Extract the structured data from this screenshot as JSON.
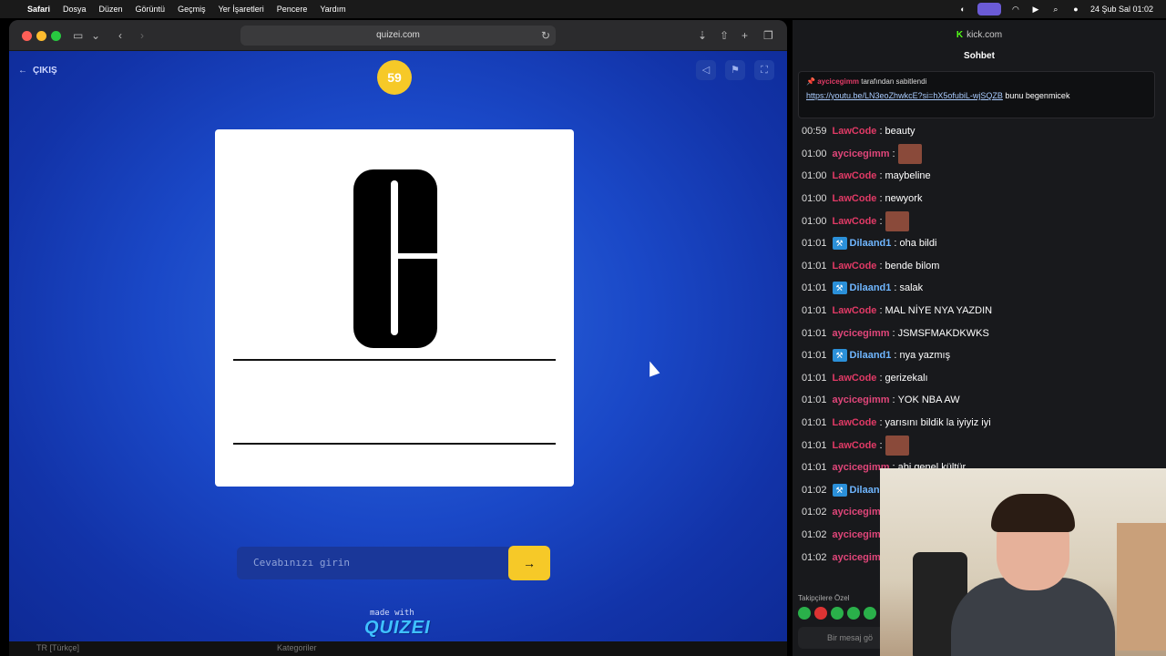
{
  "menubar": {
    "app": "Safari",
    "items": [
      "Dosya",
      "Düzen",
      "Görüntü",
      "Geçmiş",
      "Yer İşaretleri",
      "Pencere",
      "Yardım"
    ],
    "datetime": "24 Şub Sal  01:02"
  },
  "browser": {
    "url": "quizei.com"
  },
  "quiz": {
    "exit_label": "ÇIKIŞ",
    "timer": "59",
    "answer_placeholder": "Cevabınızı girin",
    "submit_label": "→",
    "made_with": "made with",
    "brand": "QUIZEI"
  },
  "bottom": {
    "lang": "TR  [Türkçe]",
    "categories": "Kategoriler"
  },
  "kick": {
    "url": "kick.com",
    "tab": "Sohbet",
    "pinned_by_user": "aycicegimm",
    "pinned_by_suffix": "tarafından sabitlendi",
    "pinned_link": "https://youtu.be/LN3eoZhwkcE?si=hX5ofubiL-wjSQZB",
    "pinned_text": "bunu begenmicek",
    "followers_only": "Takipçilere Özel",
    "message_placeholder": "Bir mesaj gö",
    "messages": [
      {
        "time": "00:59",
        "user": "LawCode",
        "type": "law",
        "text": "beauty"
      },
      {
        "time": "01:00",
        "user": "aycicegimm",
        "type": "ayc",
        "text": "",
        "emote": true
      },
      {
        "time": "01:00",
        "user": "LawCode",
        "type": "law",
        "text": "maybeline"
      },
      {
        "time": "01:00",
        "user": "LawCode",
        "type": "law",
        "text": "newyork"
      },
      {
        "time": "01:00",
        "user": "LawCode",
        "type": "law",
        "text": "",
        "emote": true
      },
      {
        "time": "01:01",
        "user": "Dilaand1",
        "type": "dil",
        "text": "oha bildi"
      },
      {
        "time": "01:01",
        "user": "LawCode",
        "type": "law",
        "text": "bende bilom"
      },
      {
        "time": "01:01",
        "user": "Dilaand1",
        "type": "dil",
        "text": "salak"
      },
      {
        "time": "01:01",
        "user": "LawCode",
        "type": "law",
        "text": "MAL NİYE NYA YAZDIN"
      },
      {
        "time": "01:01",
        "user": "aycicegimm",
        "type": "ayc",
        "text": "JSMSFMAKDKWKS"
      },
      {
        "time": "01:01",
        "user": "Dilaand1",
        "type": "dil",
        "text": "nya yazmış"
      },
      {
        "time": "01:01",
        "user": "LawCode",
        "type": "law",
        "text": "gerizekalı"
      },
      {
        "time": "01:01",
        "user": "aycicegimm",
        "type": "ayc",
        "text": "YOK NBA AW"
      },
      {
        "time": "01:01",
        "user": "LawCode",
        "type": "law",
        "text": "yarısını bildik la iyiyiz iyi"
      },
      {
        "time": "01:01",
        "user": "LawCode",
        "type": "law",
        "text": "",
        "emote": true
      },
      {
        "time": "01:01",
        "user": "aycicegimm",
        "type": "ayc",
        "text": "abi genel kültür"
      },
      {
        "time": "01:02",
        "user": "Dilaan",
        "type": "dil",
        "text": ""
      },
      {
        "time": "01:02",
        "user": "aycicegim",
        "type": "ayc",
        "text": ""
      },
      {
        "time": "01:02",
        "user": "aycicegim",
        "type": "ayc",
        "text": ""
      },
      {
        "time": "01:02",
        "user": "aycicegim",
        "type": "ayc",
        "text": ""
      }
    ]
  }
}
